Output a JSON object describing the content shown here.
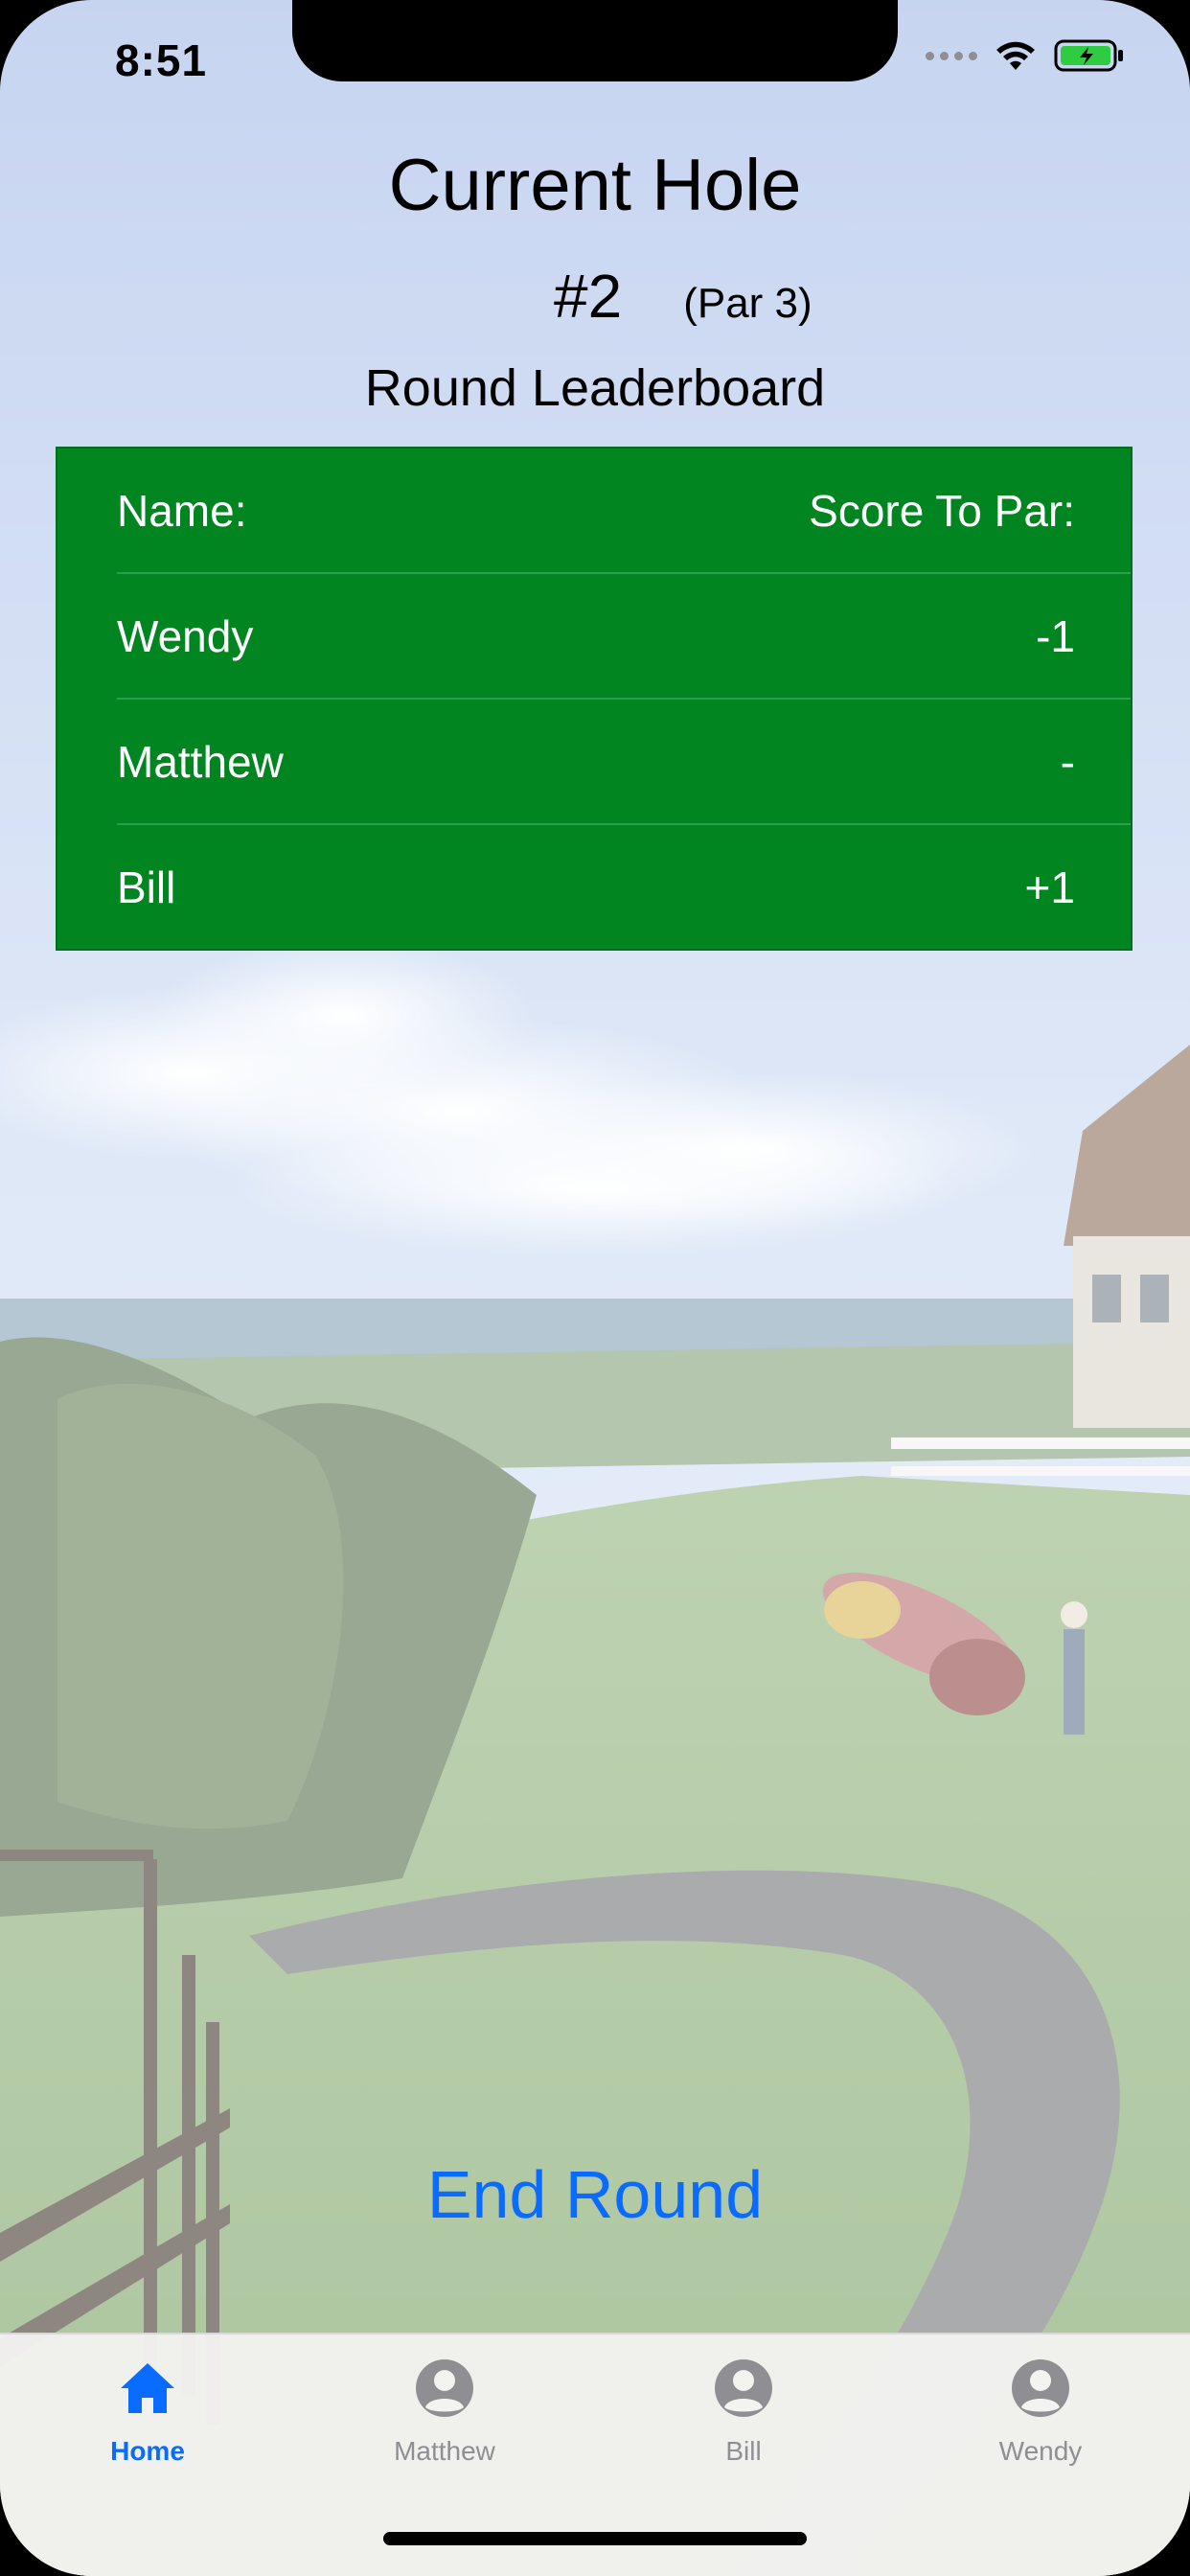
{
  "status_bar": {
    "time": "8:51",
    "signal_icon": "signal-dots-icon",
    "wifi_icon": "wifi-icon",
    "battery_icon": "battery-charging-icon",
    "battery_color": "#2ecc40"
  },
  "header": {
    "title": "Current Hole",
    "hole_number": "#2",
    "par": "(Par 3)",
    "board_title": "Round Leaderboard"
  },
  "leaderboard": {
    "background_color": "#008520",
    "columns": [
      "Name:",
      "Score To Par:"
    ],
    "rows": [
      {
        "name": "Wendy",
        "score": "-1"
      },
      {
        "name": "Matthew",
        "score": "-"
      },
      {
        "name": "Bill",
        "score": "+1"
      }
    ]
  },
  "actions": {
    "end_round_label": "End Round",
    "accent_color": "#0a6cff"
  },
  "tab_bar": {
    "tabs": [
      {
        "label": "Home",
        "icon": "house-icon",
        "active": true
      },
      {
        "label": "Matthew",
        "icon": "person-circle-icon",
        "active": false
      },
      {
        "label": "Bill",
        "icon": "person-circle-icon",
        "active": false
      },
      {
        "label": "Wendy",
        "icon": "person-circle-icon",
        "active": false
      }
    ]
  }
}
